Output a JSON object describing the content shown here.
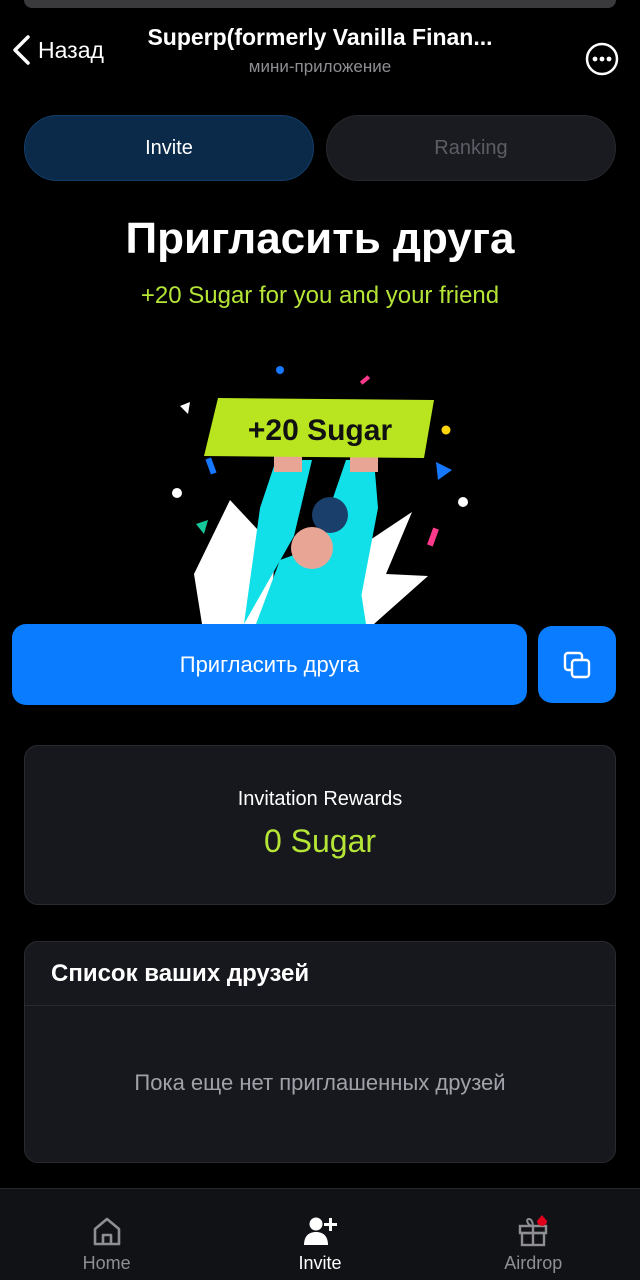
{
  "header": {
    "back_label": "Назад",
    "title": "Superp(formerly Vanilla Finan...",
    "subtitle": "мини-приложение"
  },
  "tabs": [
    {
      "label": "Invite",
      "active": true
    },
    {
      "label": "Ranking",
      "active": false
    }
  ],
  "hero": {
    "title": "Пригласить друга",
    "subtitle": "+20 Sugar for you and your friend",
    "banner_text": "+20 Sugar"
  },
  "actions": {
    "invite_label": "Пригласить друга",
    "copy_icon": "copy-icon"
  },
  "rewards": {
    "label": "Invitation Rewards",
    "value": "0 Sugar"
  },
  "friends": {
    "title": "Список ваших друзей",
    "empty_text": "Пока еще нет приглашенных друзей"
  },
  "nav": {
    "items": [
      {
        "label": "Home",
        "icon": "home-icon",
        "active": false
      },
      {
        "label": "Invite",
        "icon": "add-user-icon",
        "active": true
      },
      {
        "label": "Airdrop",
        "icon": "gift-icon",
        "active": false
      }
    ]
  },
  "colors": {
    "background": "#000000",
    "accent": "#0a7cff",
    "lime": "#b5e536",
    "card": "#17181d"
  }
}
